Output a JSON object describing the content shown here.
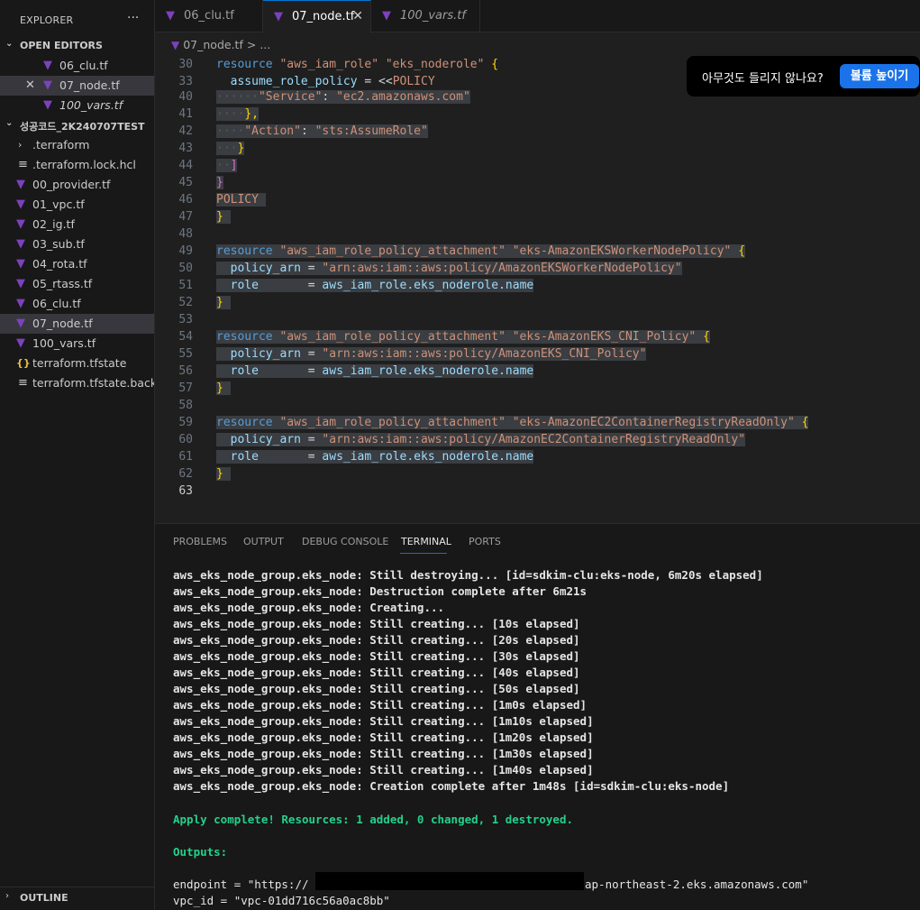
{
  "explorer": {
    "title": "EXPLORER",
    "more": "···",
    "open_editors_label": "OPEN EDITORS",
    "open_editors": [
      {
        "name": "06_clu.tf"
      },
      {
        "name": "07_node.tf"
      },
      {
        "name": "100_vars.tf"
      }
    ],
    "project_label": "성공코드_2K240707TEST",
    "files": [
      {
        "name": ".terraform",
        "icon": "chevron-right-icon"
      },
      {
        "name": ".terraform.lock.hcl",
        "icon": "lines-icon"
      },
      {
        "name": "00_provider.tf",
        "icon": "terraform-icon"
      },
      {
        "name": "01_vpc.tf",
        "icon": "terraform-icon"
      },
      {
        "name": "02_ig.tf",
        "icon": "terraform-icon"
      },
      {
        "name": "03_sub.tf",
        "icon": "terraform-icon"
      },
      {
        "name": "04_rota.tf",
        "icon": "terraform-icon"
      },
      {
        "name": "05_rtass.tf",
        "icon": "terraform-icon"
      },
      {
        "name": "06_clu.tf",
        "icon": "terraform-icon"
      },
      {
        "name": "07_node.tf",
        "icon": "terraform-icon"
      },
      {
        "name": "100_vars.tf",
        "icon": "terraform-icon"
      },
      {
        "name": "terraform.tfstate",
        "icon": "json-icon"
      },
      {
        "name": "terraform.tfstate.back...",
        "icon": "lines-icon"
      }
    ],
    "outline_label": "OUTLINE"
  },
  "tabs": [
    {
      "label": "06_clu.tf"
    },
    {
      "label": "07_node.tf"
    },
    {
      "label": "100_vars.tf"
    }
  ],
  "breadcrumb": {
    "file": "07_node.tf",
    "sep": ">",
    "rest": "..."
  },
  "notification": {
    "message": "아무것도 들리지 않나요?",
    "button": "볼륨 높이기"
  },
  "code": {
    "line_numbers": [
      "30",
      "33",
      "40",
      "41",
      "42",
      "43",
      "44",
      "45",
      "46",
      "47",
      "48",
      "49",
      "50",
      "51",
      "52",
      "53",
      "54",
      "55",
      "56",
      "57",
      "58",
      "59",
      "60",
      "61",
      "62",
      "63"
    ],
    "l30": {
      "kw": "resource",
      "s1": "\"aws_iam_role\"",
      "s2": "\"eks_noderole\"",
      "br": "{"
    },
    "l33": {
      "prop": "assume_role_policy",
      "op": "= <<",
      "hd": "POLICY"
    },
    "l40": {
      "dots": "······",
      "k": "\"Service\"",
      "colon": ":",
      "v": "\"ec2.amazonaws.com\""
    },
    "l41": {
      "dots": "····",
      "t": "},"
    },
    "l42": {
      "dots": "····",
      "k": "\"Action\"",
      "colon": ":",
      "v": "\"sts:AssumeRole\""
    },
    "l43": {
      "dots": "···",
      "t": "}"
    },
    "l44": {
      "dots": "··",
      "t": "]"
    },
    "l45": {
      "t": "}"
    },
    "l46": {
      "t": "POLICY"
    },
    "l47": {
      "t": "}"
    },
    "l49": {
      "kw": "resource",
      "s1": "\"aws_iam_role_policy_attachment\"",
      "s2": "\"eks-AmazonEKSWorkerNodePolicy\"",
      "br": "{"
    },
    "l50": {
      "prop": "policy_arn",
      "op": "=",
      "v": "\"arn:aws:iam::aws:policy/AmazonEKSWorkerNodePolicy\""
    },
    "l51": {
      "prop": "role",
      "op": "=",
      "v": "aws_iam_role.eks_noderole.name"
    },
    "l52": {
      "t": "}"
    },
    "l54": {
      "kw": "resource",
      "s1": "\"aws_iam_role_policy_attachment\"",
      "s2": "\"eks-AmazonEKS_CNI_Policy\"",
      "br": "{"
    },
    "l55": {
      "prop": "policy_arn",
      "op": "=",
      "v": "\"arn:aws:iam::aws:policy/AmazonEKS_CNI_Policy\""
    },
    "l56": {
      "prop": "role",
      "op": "=",
      "v": "aws_iam_role.eks_noderole.name"
    },
    "l57": {
      "t": "}"
    },
    "l59": {
      "kw": "resource",
      "s1": "\"aws_iam_role_policy_attachment\"",
      "s2": "\"eks-AmazonEC2ContainerRegistryReadOnly\"",
      "br": "{"
    },
    "l60": {
      "prop": "policy_arn",
      "op": "=",
      "v": "\"arn:aws:iam::aws:policy/AmazonEC2ContainerRegistryReadOnly\""
    },
    "l61": {
      "prop": "role",
      "op": "=",
      "v": "aws_iam_role.eks_noderole.name"
    },
    "l62": {
      "t": "}"
    }
  },
  "panel": {
    "tabs": [
      "PROBLEMS",
      "OUTPUT",
      "DEBUG CONSOLE",
      "TERMINAL",
      "PORTS"
    ],
    "active_tab": "TERMINAL",
    "terminal": [
      "aws_eks_node_group.eks_node: Still destroying... [id=sdkim-clu:eks-node, 6m20s elapsed]",
      "aws_eks_node_group.eks_node: Destruction complete after 6m21s",
      "aws_eks_node_group.eks_node: Creating...",
      "aws_eks_node_group.eks_node: Still creating... [10s elapsed]",
      "aws_eks_node_group.eks_node: Still creating... [20s elapsed]",
      "aws_eks_node_group.eks_node: Still creating... [30s elapsed]",
      "aws_eks_node_group.eks_node: Still creating... [40s elapsed]",
      "aws_eks_node_group.eks_node: Still creating... [50s elapsed]",
      "aws_eks_node_group.eks_node: Still creating... [1m0s elapsed]",
      "aws_eks_node_group.eks_node: Still creating... [1m10s elapsed]",
      "aws_eks_node_group.eks_node: Still creating... [1m20s elapsed]",
      "aws_eks_node_group.eks_node: Still creating... [1m30s elapsed]",
      "aws_eks_node_group.eks_node: Still creating... [1m40s elapsed]",
      "aws_eks_node_group.eks_node: Creation complete after 1m48s [id=sdkim-clu:eks-node]"
    ],
    "apply_complete": "Apply complete! Resources: 1 added, 0 changed, 1 destroyed.",
    "outputs_label": "Outputs:",
    "endpoint_prefix": "endpoint = \"https://",
    "endpoint_suffix": "ap-northeast-2.eks.amazonaws.com\"",
    "vpc_id_line": "vpc_id = \"vpc-01dd716c56a0ac8bb\""
  },
  "colors": {
    "accent": "#0078d4",
    "terraform": "#7b42bc",
    "success": "#23d18b",
    "notif_button": "#1a73e8"
  }
}
